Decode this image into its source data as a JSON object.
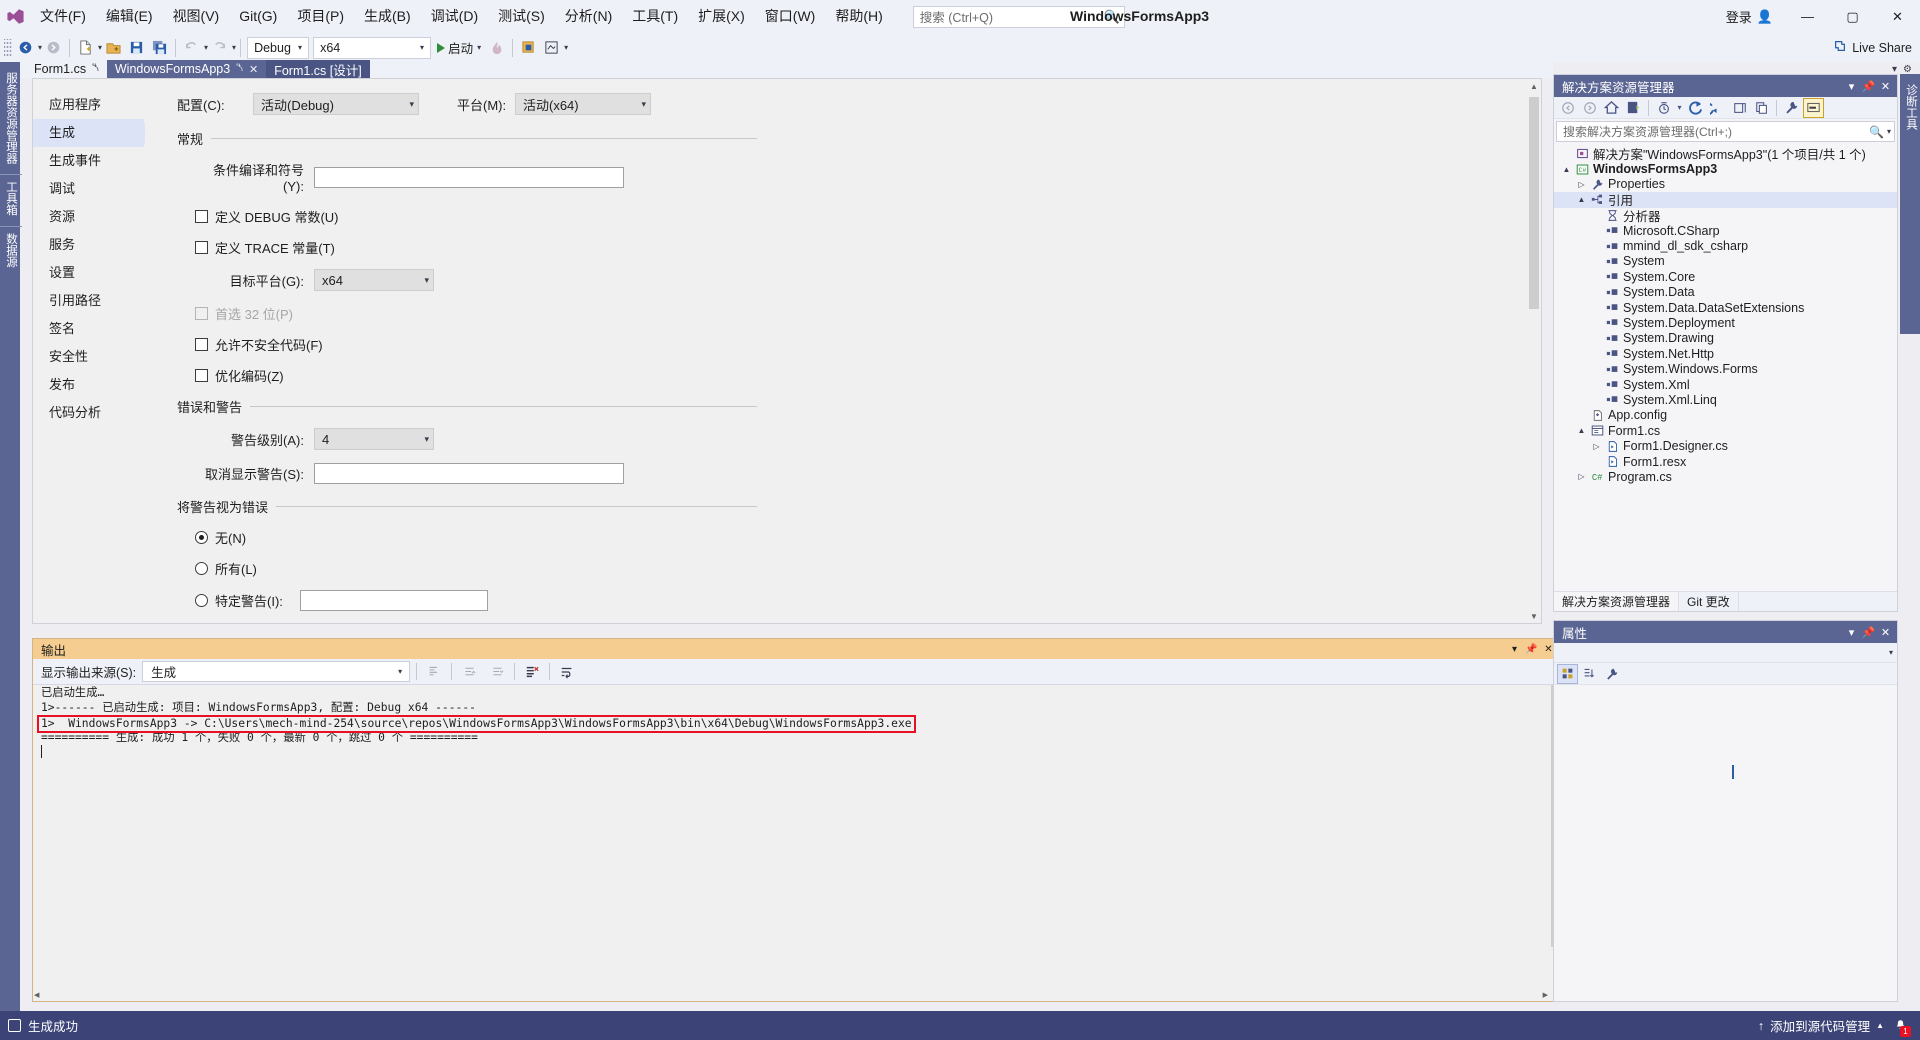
{
  "window": {
    "title": "WindowsFormsApp3",
    "signin_label": "登录",
    "minimize": "—",
    "maximize": "▢",
    "close": "✕"
  },
  "menu": {
    "items": [
      "文件(F)",
      "编辑(E)",
      "视图(V)",
      "Git(G)",
      "项目(P)",
      "生成(B)",
      "调试(D)",
      "测试(S)",
      "分析(N)",
      "工具(T)",
      "扩展(X)",
      "窗口(W)",
      "帮助(H)"
    ]
  },
  "search": {
    "placeholder": "搜索 (Ctrl+Q)",
    "icon": "search-icon"
  },
  "toolbar": {
    "config_value": "Debug",
    "platform_value": "x64",
    "run_label": "启动",
    "live_share_label": "Live Share",
    "icons": [
      "back-navigate-icon",
      "forward-navigate-icon",
      "new-file-icon",
      "open-file-icon",
      "save-icon",
      "save-all-icon",
      "undo-icon",
      "redo-icon",
      "start-debug-icon",
      "hot-reload-icon",
      "select-element-icon",
      "designer-icon"
    ]
  },
  "left_dock": {
    "tabs": [
      "服务器资源管理器",
      "工具箱",
      "数据源"
    ]
  },
  "right_dock": {
    "tabs": [
      "诊断工具"
    ]
  },
  "document_tabs": [
    {
      "label": "Form1.cs",
      "pinned": true,
      "state": "inactive"
    },
    {
      "label": "WindowsFormsApp3",
      "pinned": true,
      "closable": true,
      "state": "active"
    },
    {
      "label": "Form1.cs [设计]",
      "state": "secondary"
    }
  ],
  "property_page": {
    "categories": [
      "应用程序",
      "生成",
      "生成事件",
      "调试",
      "资源",
      "服务",
      "设置",
      "引用路径",
      "签名",
      "安全性",
      "发布",
      "代码分析"
    ],
    "active_category": "生成",
    "config_label": "配置(C):",
    "config_value": "活动(Debug)",
    "platform_label": "平台(M):",
    "platform_value": "活动(x64)",
    "groups": {
      "general": {
        "title": "常规",
        "cond_symbols_label": "条件编译和符号(Y):",
        "cond_symbols_value": "",
        "define_debug": {
          "label": "定义 DEBUG 常数(U)",
          "checked": false
        },
        "define_trace": {
          "label": "定义 TRACE 常量(T)",
          "checked": false
        },
        "target_platform_label": "目标平台(G):",
        "target_platform_value": "x64",
        "prefer32": {
          "label": "首选 32 位(P)",
          "checked": false,
          "disabled": true
        },
        "allow_unsafe": {
          "label": "允许不安全代码(F)",
          "checked": false
        },
        "optimize": {
          "label": "优化编码(Z)",
          "checked": false
        }
      },
      "errors": {
        "title": "错误和警告",
        "warn_level_label": "警告级别(A):",
        "warn_level_value": "4",
        "suppress_label": "取消显示警告(S):",
        "suppress_value": ""
      },
      "warnings_as_errors": {
        "title": "将警告视为错误",
        "options": [
          {
            "label": "无(N)",
            "selected": true
          },
          {
            "label": "所有(L)",
            "selected": false
          },
          {
            "label": "特定警告(I):",
            "selected": false,
            "value": ""
          }
        ]
      }
    }
  },
  "output": {
    "title": "输出",
    "source_label": "显示输出来源(S):",
    "source_value": "生成",
    "toolbar_icons": [
      "find-message-icon",
      "go-to-previous-icon",
      "go-to-next-icon",
      "clear-all-icon",
      "word-wrap-icon"
    ],
    "lines": [
      {
        "text": "已启动生成…",
        "highlighted": false
      },
      {
        "text": "1>------ 已启动生成: 项目: WindowsFormsApp3, 配置: Debug x64 ------",
        "highlighted": false
      },
      {
        "text": "1>  WindowsFormsApp3 -> C:\\Users\\mech-mind-254\\source\\repos\\WindowsFormsApp3\\WindowsFormsApp3\\bin\\x64\\Debug\\WindowsFormsApp3.exe",
        "highlighted": true
      },
      {
        "text": "========== 生成: 成功 1 个，失败 0 个，最新 0 个，跳过 0 个 ==========",
        "highlighted": false
      }
    ],
    "highlight_color": "#e81123"
  },
  "solution_explorer": {
    "title": "解决方案资源管理器",
    "search_placeholder": "搜索解决方案资源管理器(Ctrl+;)",
    "toolbar_icons": [
      "back-icon",
      "forward-icon",
      "home-icon",
      "sync-with-active-document-icon",
      "pending-changes-filter-icon",
      "refresh-icon",
      "collapse-all-icon",
      "show-all-files-icon",
      "copy-icon",
      "properties-icon",
      "preview-selected-items-icon"
    ],
    "tree": [
      {
        "indent": 0,
        "expander": "",
        "icon": "solution-icon",
        "label": "解决方案\"WindowsFormsApp3\"(1 个项目/共 1 个)",
        "bold": false,
        "selected": false
      },
      {
        "indent": 0,
        "expander": "▲",
        "icon": "csharp-project-icon",
        "label": "WindowsFormsApp3",
        "bold": true,
        "selected": false
      },
      {
        "indent": 1,
        "expander": "▷",
        "icon": "properties-wrench-icon",
        "label": "Properties",
        "bold": false,
        "selected": false
      },
      {
        "indent": 1,
        "expander": "▲",
        "icon": "references-icon",
        "label": "引用",
        "bold": false,
        "selected": true
      },
      {
        "indent": 2,
        "expander": "",
        "icon": "analyzer-icon",
        "label": "分析器",
        "bold": false,
        "selected": false
      },
      {
        "indent": 2,
        "expander": "",
        "icon": "assembly-icon",
        "label": "Microsoft.CSharp",
        "bold": false,
        "selected": false
      },
      {
        "indent": 2,
        "expander": "",
        "icon": "assembly-icon",
        "label": "mmind_dl_sdk_csharp",
        "bold": false,
        "selected": false
      },
      {
        "indent": 2,
        "expander": "",
        "icon": "assembly-icon",
        "label": "System",
        "bold": false,
        "selected": false
      },
      {
        "indent": 2,
        "expander": "",
        "icon": "assembly-icon",
        "label": "System.Core",
        "bold": false,
        "selected": false
      },
      {
        "indent": 2,
        "expander": "",
        "icon": "assembly-icon",
        "label": "System.Data",
        "bold": false,
        "selected": false
      },
      {
        "indent": 2,
        "expander": "",
        "icon": "assembly-icon",
        "label": "System.Data.DataSetExtensions",
        "bold": false,
        "selected": false
      },
      {
        "indent": 2,
        "expander": "",
        "icon": "assembly-icon",
        "label": "System.Deployment",
        "bold": false,
        "selected": false
      },
      {
        "indent": 2,
        "expander": "",
        "icon": "assembly-icon",
        "label": "System.Drawing",
        "bold": false,
        "selected": false
      },
      {
        "indent": 2,
        "expander": "",
        "icon": "assembly-icon",
        "label": "System.Net.Http",
        "bold": false,
        "selected": false
      },
      {
        "indent": 2,
        "expander": "",
        "icon": "assembly-icon",
        "label": "System.Windows.Forms",
        "bold": false,
        "selected": false
      },
      {
        "indent": 2,
        "expander": "",
        "icon": "assembly-icon",
        "label": "System.Xml",
        "bold": false,
        "selected": false
      },
      {
        "indent": 2,
        "expander": "",
        "icon": "assembly-icon",
        "label": "System.Xml.Linq",
        "bold": false,
        "selected": false
      },
      {
        "indent": 1,
        "expander": "",
        "icon": "config-file-icon",
        "label": "App.config",
        "bold": false,
        "selected": false
      },
      {
        "indent": 1,
        "expander": "▲",
        "icon": "form-icon",
        "label": "Form1.cs",
        "bold": false,
        "selected": false
      },
      {
        "indent": 2,
        "expander": "▷",
        "icon": "csharp-file-icon",
        "label": "Form1.Designer.cs",
        "bold": false,
        "selected": false
      },
      {
        "indent": 2,
        "expander": "",
        "icon": "resx-file-icon",
        "label": "Form1.resx",
        "bold": false,
        "selected": false
      },
      {
        "indent": 1,
        "expander": "▷",
        "icon": "csharp-class-icon",
        "label": "Program.cs",
        "bold": false,
        "selected": false
      }
    ],
    "bottom_tabs": [
      {
        "label": "解决方案资源管理器",
        "active": true
      },
      {
        "label": "Git 更改",
        "active": false
      }
    ]
  },
  "properties_panel": {
    "title": "属性",
    "toolbar_icons": [
      "categorized-icon",
      "alphabetical-icon",
      "properties-wrench-icon"
    ]
  },
  "status_bar": {
    "build_status": "生成成功",
    "source_control_label": "添加到源代码管理",
    "source_control_caret": "▲",
    "notification_count": "1",
    "background": "#3c4477"
  },
  "colors": {
    "accent": "#5a6593",
    "menu_bg": "#eff1f8",
    "panel_bg": "#f5f5f8",
    "editor_bg": "#f0f0f0",
    "status_bg": "#3c4477",
    "output_header": "#f6cd90",
    "selection": "#dde3f7",
    "error_red": "#e81123"
  }
}
